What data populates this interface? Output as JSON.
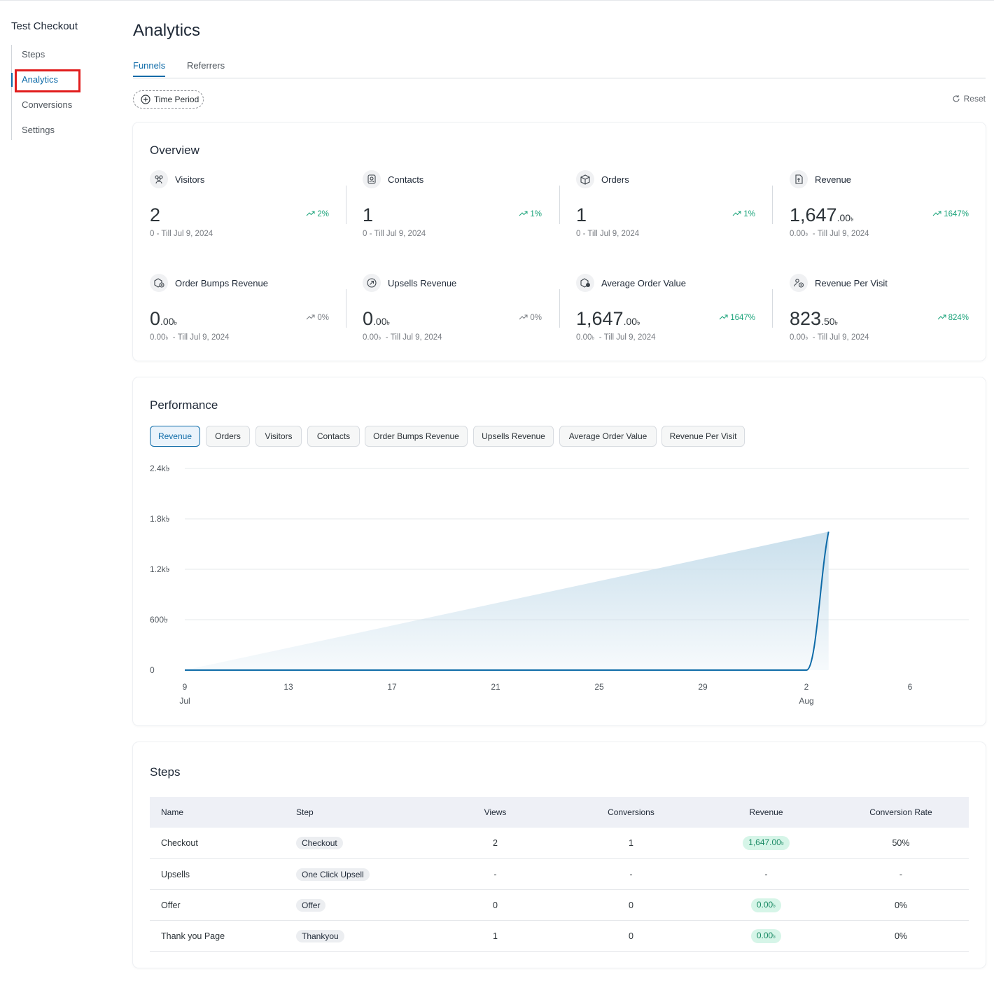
{
  "sidebar": {
    "title": "Test Checkout",
    "items": [
      {
        "label": "Steps"
      },
      {
        "label": "Analytics"
      },
      {
        "label": "Conversions"
      },
      {
        "label": "Settings"
      }
    ],
    "active": "Analytics"
  },
  "header": {
    "title": "Analytics",
    "tabs": [
      {
        "label": "Funnels"
      },
      {
        "label": "Referrers"
      }
    ],
    "active_tab": "Funnels"
  },
  "filters": {
    "time_period": "Time Period",
    "reset": "Reset"
  },
  "overview": {
    "title": "Overview",
    "metrics": [
      {
        "label": "Visitors",
        "int": "2",
        "dec": "",
        "cur": "",
        "trend": "2%",
        "sub_val": "0",
        "sub_cur": "",
        "sub_text": " - Till Jul 9, 2024",
        "icon": "visitors-icon"
      },
      {
        "label": "Contacts",
        "int": "1",
        "dec": "",
        "cur": "",
        "trend": "1%",
        "sub_val": "0",
        "sub_cur": "",
        "sub_text": " - Till Jul 9, 2024",
        "icon": "contacts-icon"
      },
      {
        "label": "Orders",
        "int": "1",
        "dec": "",
        "cur": "",
        "trend": "1%",
        "sub_val": "0",
        "sub_cur": "",
        "sub_text": " - Till Jul 9, 2024",
        "icon": "box-icon"
      },
      {
        "label": "Revenue",
        "int": "1,647",
        "dec": ".00",
        "cur": "৳",
        "trend": "1647%",
        "sub_val": "0.00",
        "sub_cur": "৳",
        "sub_text": "  - Till Jul 9, 2024",
        "icon": "revenue-icon"
      },
      {
        "label": "Order Bumps Revenue",
        "int": "0",
        "dec": ".00",
        "cur": "৳",
        "trend": "0%",
        "sub_val": "0.00",
        "sub_cur": "৳",
        "sub_text": "  - Till Jul 9, 2024",
        "icon": "order-bump-icon"
      },
      {
        "label": "Upsells Revenue",
        "int": "0",
        "dec": ".00",
        "cur": "৳",
        "trend": "0%",
        "sub_val": "0.00",
        "sub_cur": "৳",
        "sub_text": "  - Till Jul 9, 2024",
        "icon": "upsell-icon"
      },
      {
        "label": "Average Order Value",
        "int": "1,647",
        "dec": ".00",
        "cur": "৳",
        "trend": "1647%",
        "sub_val": "0.00",
        "sub_cur": "৳",
        "sub_text": "  - Till Jul 9, 2024",
        "icon": "average-order-icon"
      },
      {
        "label": "Revenue Per Visit",
        "int": "823",
        "dec": ".50",
        "cur": "৳",
        "trend": "824%",
        "sub_val": "0.00",
        "sub_cur": "৳",
        "sub_text": "  - Till Jul 9, 2024",
        "icon": "revenue-per-visit-icon"
      }
    ]
  },
  "performance": {
    "title": "Performance",
    "chips": [
      "Revenue",
      "Orders",
      "Visitors",
      "Contacts",
      "Order Bumps Revenue",
      "Upsells Revenue",
      "Average Order Value",
      "Revenue Per Visit"
    ],
    "active_chip": "Revenue"
  },
  "chart_data": {
    "type": "area",
    "title": "",
    "xlabel": "",
    "ylabel": "",
    "y_ticks": [
      "0",
      "600৳",
      "1.2k৳",
      "1.8k৳",
      "2.4k৳"
    ],
    "ylim": [
      0,
      2400
    ],
    "x_ticks": [
      {
        "day": "9",
        "month": "Jul"
      },
      {
        "day": "13",
        "month": ""
      },
      {
        "day": "17",
        "month": ""
      },
      {
        "day": "21",
        "month": ""
      },
      {
        "day": "25",
        "month": ""
      },
      {
        "day": "29",
        "month": ""
      },
      {
        "day": "2",
        "month": "Aug"
      },
      {
        "day": "6",
        "month": ""
      }
    ],
    "x_start": "2024-07-09",
    "x_end": "2024-08-07",
    "series": [
      {
        "name": "",
        "points": [
          {
            "x": "2024-07-09",
            "y": 0
          },
          {
            "x": "2024-08-06",
            "y": 0
          },
          {
            "x": "2024-08-07",
            "y": 1647
          }
        ]
      }
    ],
    "colors": {
      "line": "#0e6ba8",
      "fill": "#c9dfec",
      "grid": "#e6e8eb"
    },
    "grid": true
  },
  "steps": {
    "title": "Steps",
    "columns": [
      "Name",
      "Step",
      "Views",
      "Conversions",
      "Revenue",
      "Conversion Rate"
    ],
    "rows": [
      {
        "name": "Checkout",
        "step": "Checkout",
        "views": "2",
        "conversions": "1",
        "revenue": "1,647.00",
        "revenue_cur": "৳",
        "rate": "50%"
      },
      {
        "name": "Upsells",
        "step": "One Click Upsell",
        "views": "-",
        "conversions": "-",
        "revenue": "-",
        "revenue_cur": "",
        "rate": "-"
      },
      {
        "name": "Offer",
        "step": "Offer",
        "views": "0",
        "conversions": "0",
        "revenue": "0.00",
        "revenue_cur": "৳",
        "rate": "0%"
      },
      {
        "name": "Thank you Page",
        "step": "Thankyou",
        "views": "1",
        "conversions": "0",
        "revenue": "0.00",
        "revenue_cur": "৳",
        "rate": "0%"
      }
    ]
  }
}
